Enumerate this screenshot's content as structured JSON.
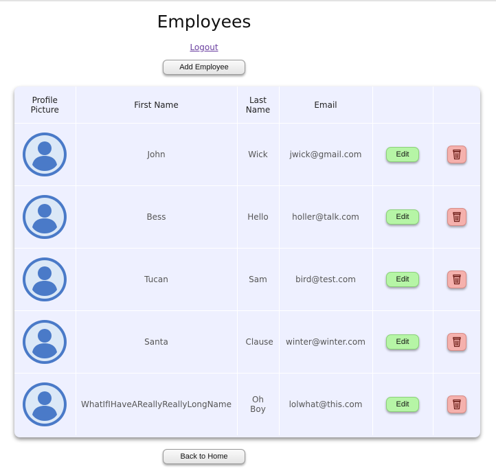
{
  "header": {
    "title": "Employees",
    "logout_label": "Logout",
    "add_label": "Add Employee"
  },
  "table": {
    "columns": [
      "Profile Picture",
      "First Name",
      "Last Name",
      "Email",
      "",
      ""
    ],
    "rows": [
      {
        "first": "John",
        "last": "Wick",
        "email": "jwick@gmail.com",
        "edit": "Edit",
        "avatar_icon": "user-avatar-icon",
        "delete_icon": "trash-icon"
      },
      {
        "first": "Bess",
        "last": "Hello",
        "email": "holler@talk.com",
        "edit": "Edit",
        "avatar_icon": "user-avatar-icon",
        "delete_icon": "trash-icon"
      },
      {
        "first": "Tucan",
        "last": "Sam",
        "email": "bird@test.com",
        "edit": "Edit",
        "avatar_icon": "user-avatar-icon",
        "delete_icon": "trash-icon"
      },
      {
        "first": "Santa",
        "last": "Clause",
        "email": "winter@winter.com",
        "edit": "Edit",
        "avatar_icon": "user-avatar-icon",
        "delete_icon": "trash-icon"
      },
      {
        "first": "WhatIfIHaveAReallyReallyLongName",
        "last": "Oh Boy",
        "email": "lolwhat@this.com",
        "edit": "Edit",
        "avatar_icon": "user-avatar-icon",
        "delete_icon": "trash-icon"
      }
    ]
  },
  "footer": {
    "home_label": "Back to Home"
  },
  "colors": {
    "avatar": "#4a7ac8",
    "avatar_figure": "#dbe8f7",
    "edit_bg": "#b6f5a6",
    "delete_bg": "#f5b1ad",
    "table_bg": "#eef0ff"
  }
}
